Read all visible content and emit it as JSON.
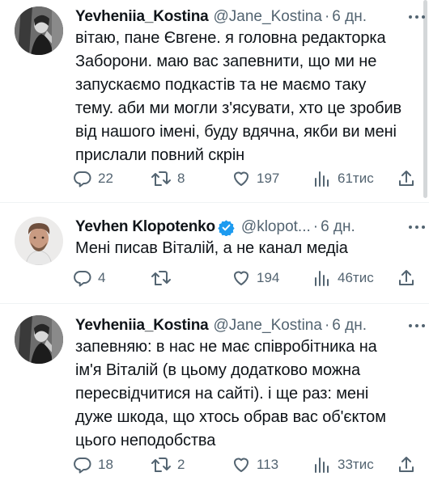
{
  "tweets": [
    {
      "name": "Yevheniia_Kostina",
      "handle": "@Jane_Kostina",
      "separator": "·",
      "time": "6 дн.",
      "text": "вітаю, пане Євгене. я головна редакторка Заборони. маю вас запевнити, що ми не запускаємо подкастів та не маємо таку тему. аби ми могли з'ясувати, хто це зробив від нашого імені, буду вдячна, якби ви мені прислали повний скрін",
      "replies": "22",
      "reposts": "8",
      "likes": "197",
      "views": "61тис",
      "verified": false
    },
    {
      "name": "Yevhen Klopotenko",
      "handle": "@klopot...",
      "separator": "·",
      "time": "6 дн.",
      "text": "Мені писав Віталій, а не канал медіа",
      "replies": "4",
      "reposts": "",
      "likes": "194",
      "views": "46тис",
      "verified": true
    },
    {
      "name": "Yevheniia_Kostina",
      "handle": "@Jane_Kostina",
      "separator": "·",
      "time": "6 дн.",
      "text": "запевняю: в нас не має співробітника на ім'я Віталій (в цьому додатково можна пересвідчитися на сайті). і ще раз: мені дуже шкода, що хтось обрав вас об'єктом цього неподобства",
      "replies": "18",
      "reposts": "2",
      "likes": "113",
      "views": "33тис",
      "verified": false
    }
  ],
  "icons": {
    "reply": "reply-icon",
    "repost": "repost-icon",
    "like": "heart-icon",
    "views": "views-icon",
    "share": "share-icon",
    "more": "more-icon",
    "verified": "verified-badge-icon"
  },
  "colors": {
    "text": "#0f1419",
    "secondary": "#536471",
    "verified": "#1d9bf0",
    "divider": "#eff3f4"
  }
}
